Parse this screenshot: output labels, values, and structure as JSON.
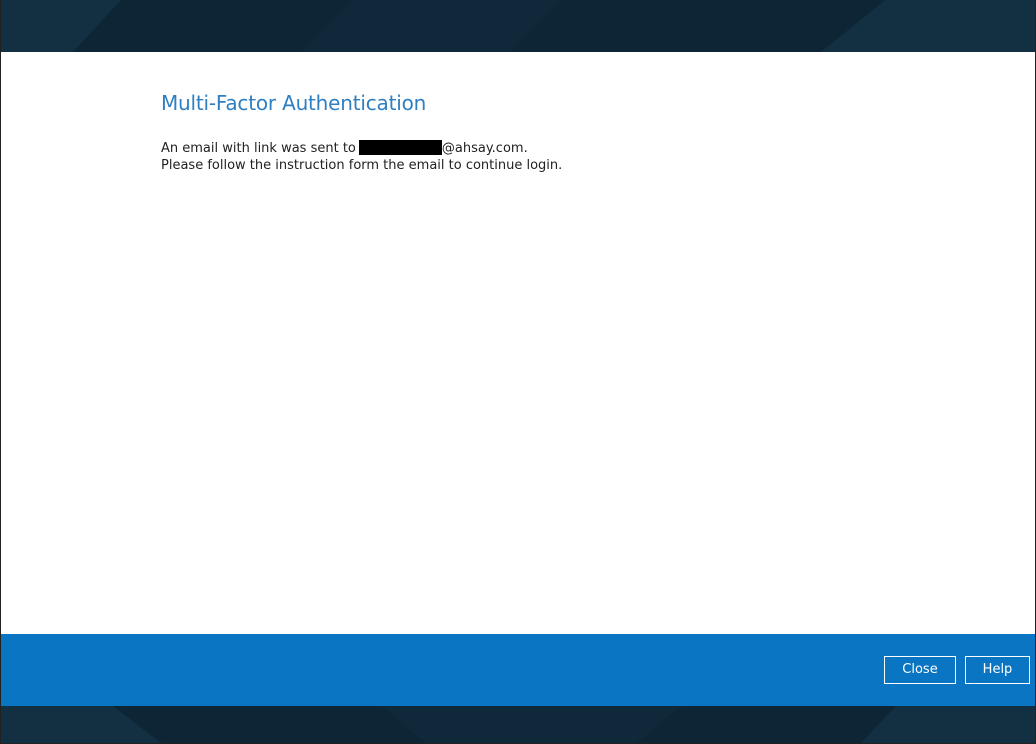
{
  "dialog": {
    "title": "Multi-Factor Authentication",
    "message_prefix": "An email with link was sent to",
    "email_domain": "@ahsay.com.",
    "message_line2": "Please follow the instruction form the email to continue login."
  },
  "actions": {
    "close_label": "Close",
    "help_label": "Help"
  },
  "colors": {
    "header_background": "#0e2535",
    "title_color": "#2f7fc1",
    "action_bar_background": "#0a75c2",
    "redaction": "#000000"
  }
}
